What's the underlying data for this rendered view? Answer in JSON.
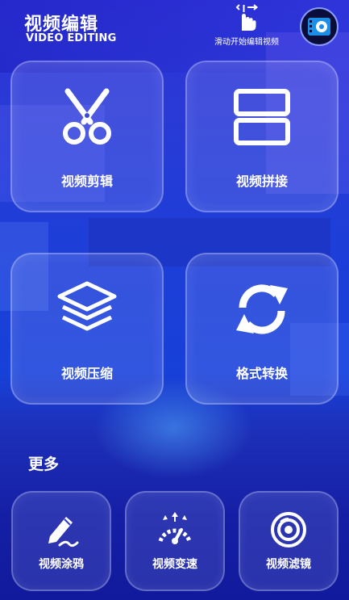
{
  "header": {
    "title_cn": "视频编辑",
    "title_en": "VIDEO EDITING",
    "gesture_hint": "滑动开始编辑视频",
    "gesture_icon": "swipe-hand-icon",
    "avatar_icon": "app-avatar-icon"
  },
  "main_tools": [
    {
      "label": "视频剪辑",
      "icon": "scissors-icon"
    },
    {
      "label": "视频拼接",
      "icon": "split-screen-icon"
    },
    {
      "label": "视频压缩",
      "icon": "layers-icon"
    },
    {
      "label": "格式转换",
      "icon": "convert-arrows-icon"
    }
  ],
  "more": {
    "title": "更多",
    "items": [
      {
        "label": "视频涂鸦",
        "icon": "pen-icon"
      },
      {
        "label": "视频变速",
        "icon": "speedometer-icon"
      },
      {
        "label": "视频滤镜",
        "icon": "camera-lens-icon"
      }
    ]
  },
  "colors": {
    "background_top": "#2d33d8",
    "background_bottom": "#111a9c",
    "glow": "#50aaff",
    "text": "#ffffff"
  }
}
